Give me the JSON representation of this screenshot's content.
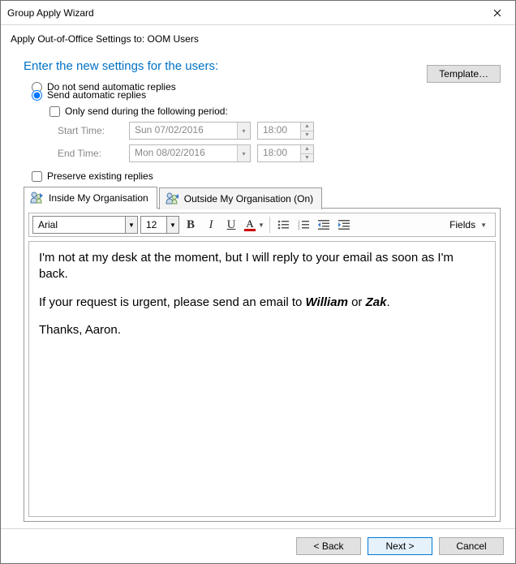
{
  "window": {
    "title": "Group Apply Wizard",
    "subtitle": "Apply Out-of-Office Settings to: OOM Users"
  },
  "section_heading": "Enter the new settings for the users:",
  "radios": {
    "no_reply": "Do not send automatic replies",
    "send_reply": "Send automatic replies"
  },
  "template_button": "Template…",
  "period": {
    "only_send_label": "Only send during the following period:",
    "start_label": "Start Time:",
    "end_label": "End Time:",
    "start_date": "Sun 07/02/2016",
    "start_time": "18:00",
    "end_date": "Mon 08/02/2016",
    "end_time": "18:00"
  },
  "preserve_label": "Preserve existing replies",
  "tabs": {
    "inside": "Inside My Organisation",
    "outside": "Outside My Organisation (On)"
  },
  "toolbar": {
    "font": "Arial",
    "size": "12",
    "fields": "Fields"
  },
  "message": {
    "p1": "I'm not at my desk at the moment, but I will reply to your email as soon as I'm back.",
    "p2a": "If your request is urgent, please send an email to ",
    "p2b": "William",
    "p2c": " or ",
    "p2d": "Zak",
    "p2e": ".",
    "p3": "Thanks, Aaron."
  },
  "footer": {
    "back": "< Back",
    "next": "Next >",
    "cancel": "Cancel"
  }
}
